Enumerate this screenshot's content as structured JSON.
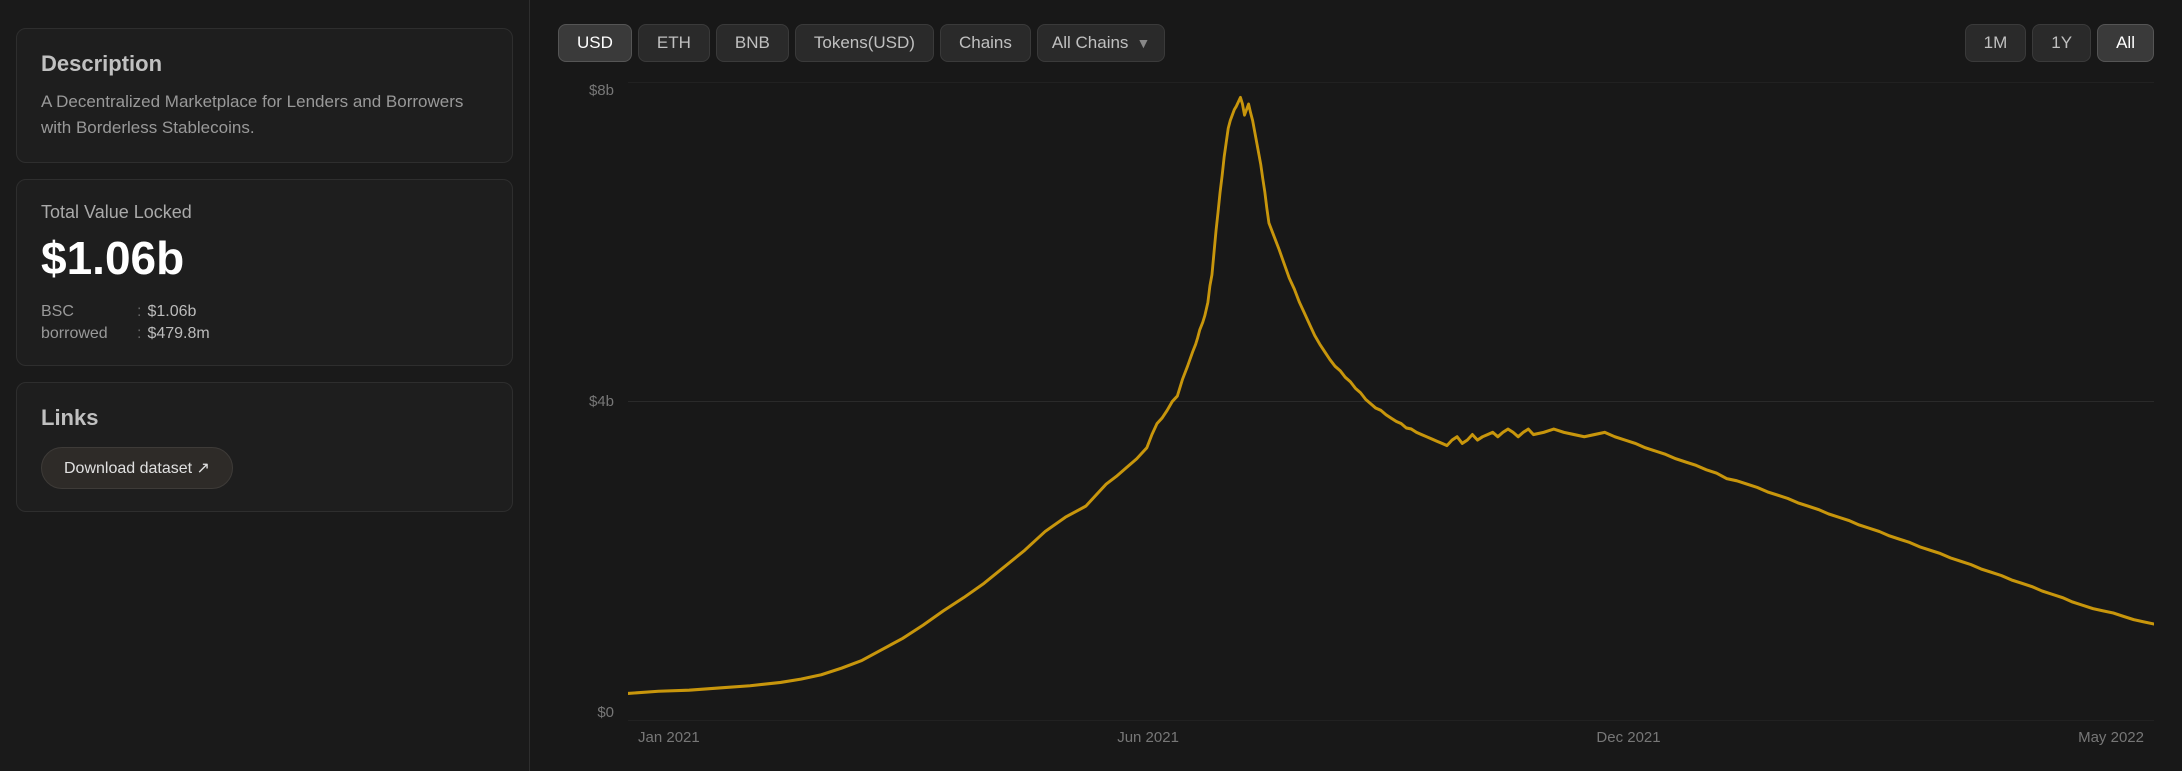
{
  "leftPanel": {
    "descriptionSection": {
      "title": "Description",
      "text": "A Decentralized Marketplace for Lenders and Borrowers with Borderless Stablecoins."
    },
    "tvlSection": {
      "label": "Total Value Locked",
      "value": "$1.06b",
      "rows": [
        {
          "key": "BSC",
          "sep": ":",
          "val": "$1.06b"
        },
        {
          "key": "borrowed",
          "sep": ":",
          "val": "$479.8m"
        }
      ]
    },
    "linksSection": {
      "title": "Links",
      "downloadLabel": "Download dataset ↗"
    }
  },
  "chart": {
    "toolbar": {
      "buttons": [
        {
          "label": "USD",
          "active": true
        },
        {
          "label": "ETH",
          "active": false
        },
        {
          "label": "BNB",
          "active": false
        },
        {
          "label": "Tokens(USD)",
          "active": false
        },
        {
          "label": "Chains",
          "active": false
        }
      ],
      "chainsDropdown": "All Chains",
      "timeButtons": [
        {
          "label": "1M",
          "active": false
        },
        {
          "label": "1Y",
          "active": false
        },
        {
          "label": "All",
          "active": true
        }
      ]
    },
    "yLabels": [
      "$8b",
      "$4b",
      "$0"
    ],
    "xLabels": [
      "Jan 2021",
      "Jun 2021",
      "Dec 2021",
      "May 2022"
    ],
    "lineColor": "#c8960c"
  }
}
